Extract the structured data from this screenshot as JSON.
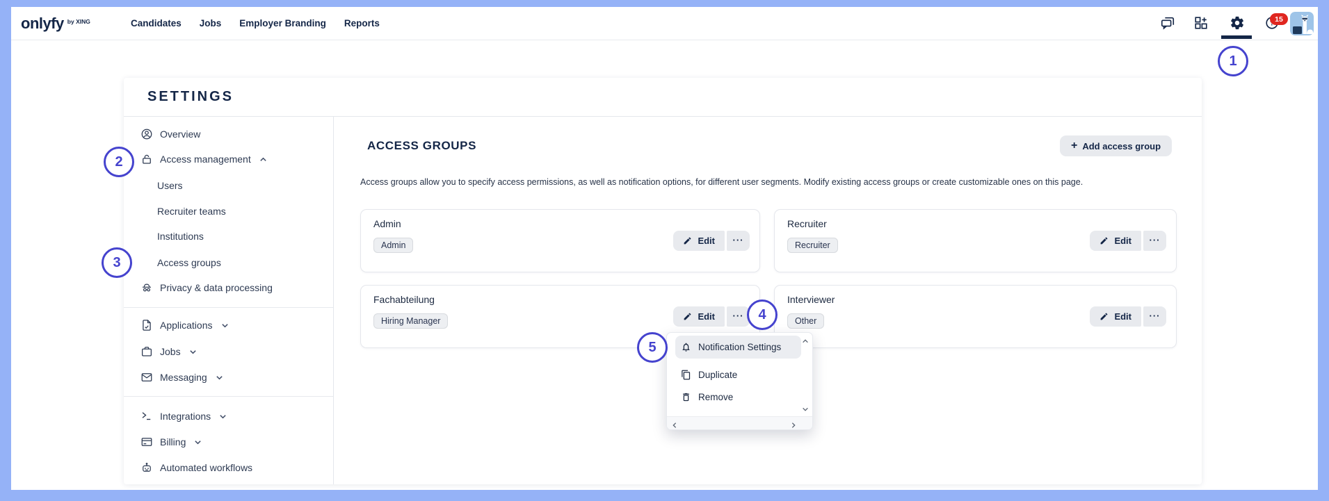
{
  "colors": {
    "frame": "#95b2f7",
    "navy": "#142647",
    "accent": "#4543ce",
    "badge_red": "#e0261f",
    "button_gray": "#e8eaee"
  },
  "nav": {
    "logo": "onlyfy",
    "logo_suffix": "by XING",
    "links": [
      {
        "label": "Candidates"
      },
      {
        "label": "Jobs"
      },
      {
        "label": "Employer Branding"
      },
      {
        "label": "Reports"
      }
    ],
    "help_badge": "15"
  },
  "page_title": "SETTINGS",
  "sidebar": {
    "items": [
      {
        "label": "Overview",
        "icon": "user-circle"
      },
      {
        "label": "Access management",
        "icon": "lock",
        "chevron": "up"
      },
      {
        "label": "Users",
        "sub": true
      },
      {
        "label": "Recruiter teams",
        "sub": true
      },
      {
        "label": "Institutions",
        "sub": true
      },
      {
        "label": "Access groups",
        "sub": true
      },
      {
        "label": "Privacy & data processing",
        "icon": "incognito"
      },
      {
        "label": "Applications",
        "icon": "file",
        "chevron": "down"
      },
      {
        "label": "Jobs",
        "icon": "briefcase",
        "chevron": "down"
      },
      {
        "label": "Messaging",
        "icon": "mail",
        "chevron": "down"
      },
      {
        "label": "Integrations",
        "icon": "terminal",
        "chevron": "down"
      },
      {
        "label": "Billing",
        "icon": "credit-card",
        "chevron": "down"
      },
      {
        "label": "Automated workflows",
        "icon": "robot"
      }
    ]
  },
  "main": {
    "heading": "ACCESS GROUPS",
    "add_button": {
      "icon": "+",
      "label": "Add access group"
    },
    "description": "Access groups allow you to specify access permissions, as well as notification options, for different user segments. Modify existing access groups or create customizable ones on this page.",
    "cards": [
      {
        "title": "Admin",
        "tag": "Admin",
        "edit_label": "Edit",
        "more_label": "···"
      },
      {
        "title": "Recruiter",
        "tag": "Recruiter",
        "edit_label": "Edit",
        "more_label": "···"
      },
      {
        "title": "Fachabteilung",
        "tag": "Hiring Manager",
        "edit_label": "Edit",
        "more_label": "···"
      },
      {
        "title": "Interviewer",
        "tag": "Other",
        "edit_label": "Edit",
        "more_label": "···"
      }
    ]
  },
  "context_menu": {
    "items": [
      {
        "label": "Notification Settings",
        "icon": "bell",
        "highlighted": true
      },
      {
        "label": "Duplicate",
        "icon": "copy"
      },
      {
        "label": "Remove",
        "icon": "trash"
      }
    ]
  },
  "annotations": {
    "steps": [
      "1",
      "2",
      "3",
      "4",
      "5"
    ]
  }
}
